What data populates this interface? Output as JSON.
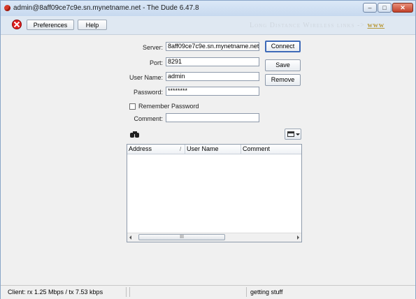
{
  "window": {
    "title": "admin@8aff09ce7c9e.sn.mynetname.net - The Dude 6.47.8",
    "buttons": {
      "minimize": "–",
      "maximize": "□",
      "close": "✕"
    }
  },
  "toolbar": {
    "preferences_label": "Preferences",
    "help_label": "Help",
    "banner_text": "Long Distance Wireless links -> ",
    "banner_link": "www"
  },
  "login_form": {
    "server_label": "Server:",
    "server_value": "8aff09ce7c9e.sn.mynetname.net",
    "port_label": "Port:",
    "port_value": "8291",
    "username_label": "User Name:",
    "username_value": "admin",
    "password_label": "Password:",
    "password_value": "********",
    "remember_label": "Remember Password",
    "remember_checked": false,
    "comment_label": "Comment:",
    "comment_value": "",
    "connect_label": "Connect",
    "save_label": "Save",
    "remove_label": "Remove"
  },
  "saved_logins_table": {
    "columns": [
      "Address",
      "User Name",
      "Comment"
    ],
    "sort_indicator": "/",
    "rows": [],
    "scroll_thumb_grip": "III"
  },
  "statusbar": {
    "client_text": "Client: rx 1.25 Mbps / tx 7.53 kbps",
    "middle_text": "",
    "message_text": "getting stuff"
  },
  "icons": {
    "app": "dude-app-icon",
    "stop": "stop-icon",
    "find": "binoculars-icon",
    "columns": "column-chooser-icon"
  }
}
